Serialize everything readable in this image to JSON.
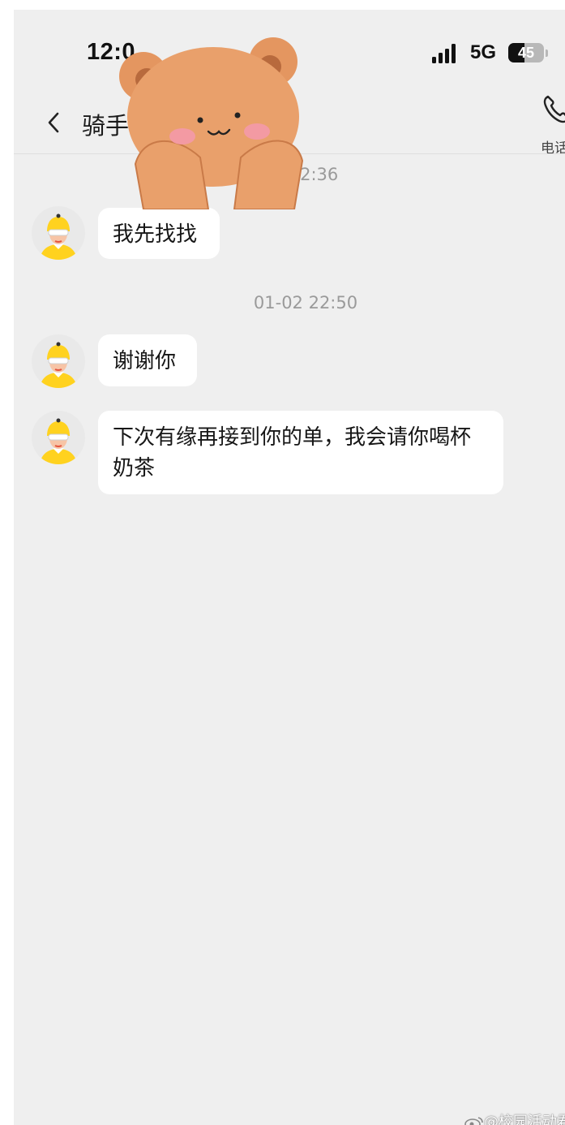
{
  "status_bar": {
    "time": "12:0",
    "network": "5G",
    "battery": "45",
    "battery_level": 0.45
  },
  "header": {
    "title": "骑手王",
    "call_label": "电话"
  },
  "messages": [
    {
      "timestamp": "2 22:36",
      "text": "我先找找"
    },
    {
      "timestamp": "01-02 22:50",
      "text": "谢谢你"
    },
    {
      "text": "下次有缘再接到你的单，我会请你喝杯奶茶"
    }
  ],
  "sticker": {
    "name": "bear-sticker"
  },
  "watermark": {
    "text": "@校园活动君"
  },
  "colors": {
    "background": "#efefef",
    "bubble": "#ffffff",
    "timestamp": "#9a9a9a",
    "helmet_yellow": "#ffd21f"
  },
  "icons": [
    "back-arrow-icon",
    "phone-icon",
    "signal-icon",
    "battery-icon",
    "weibo-icon"
  ]
}
